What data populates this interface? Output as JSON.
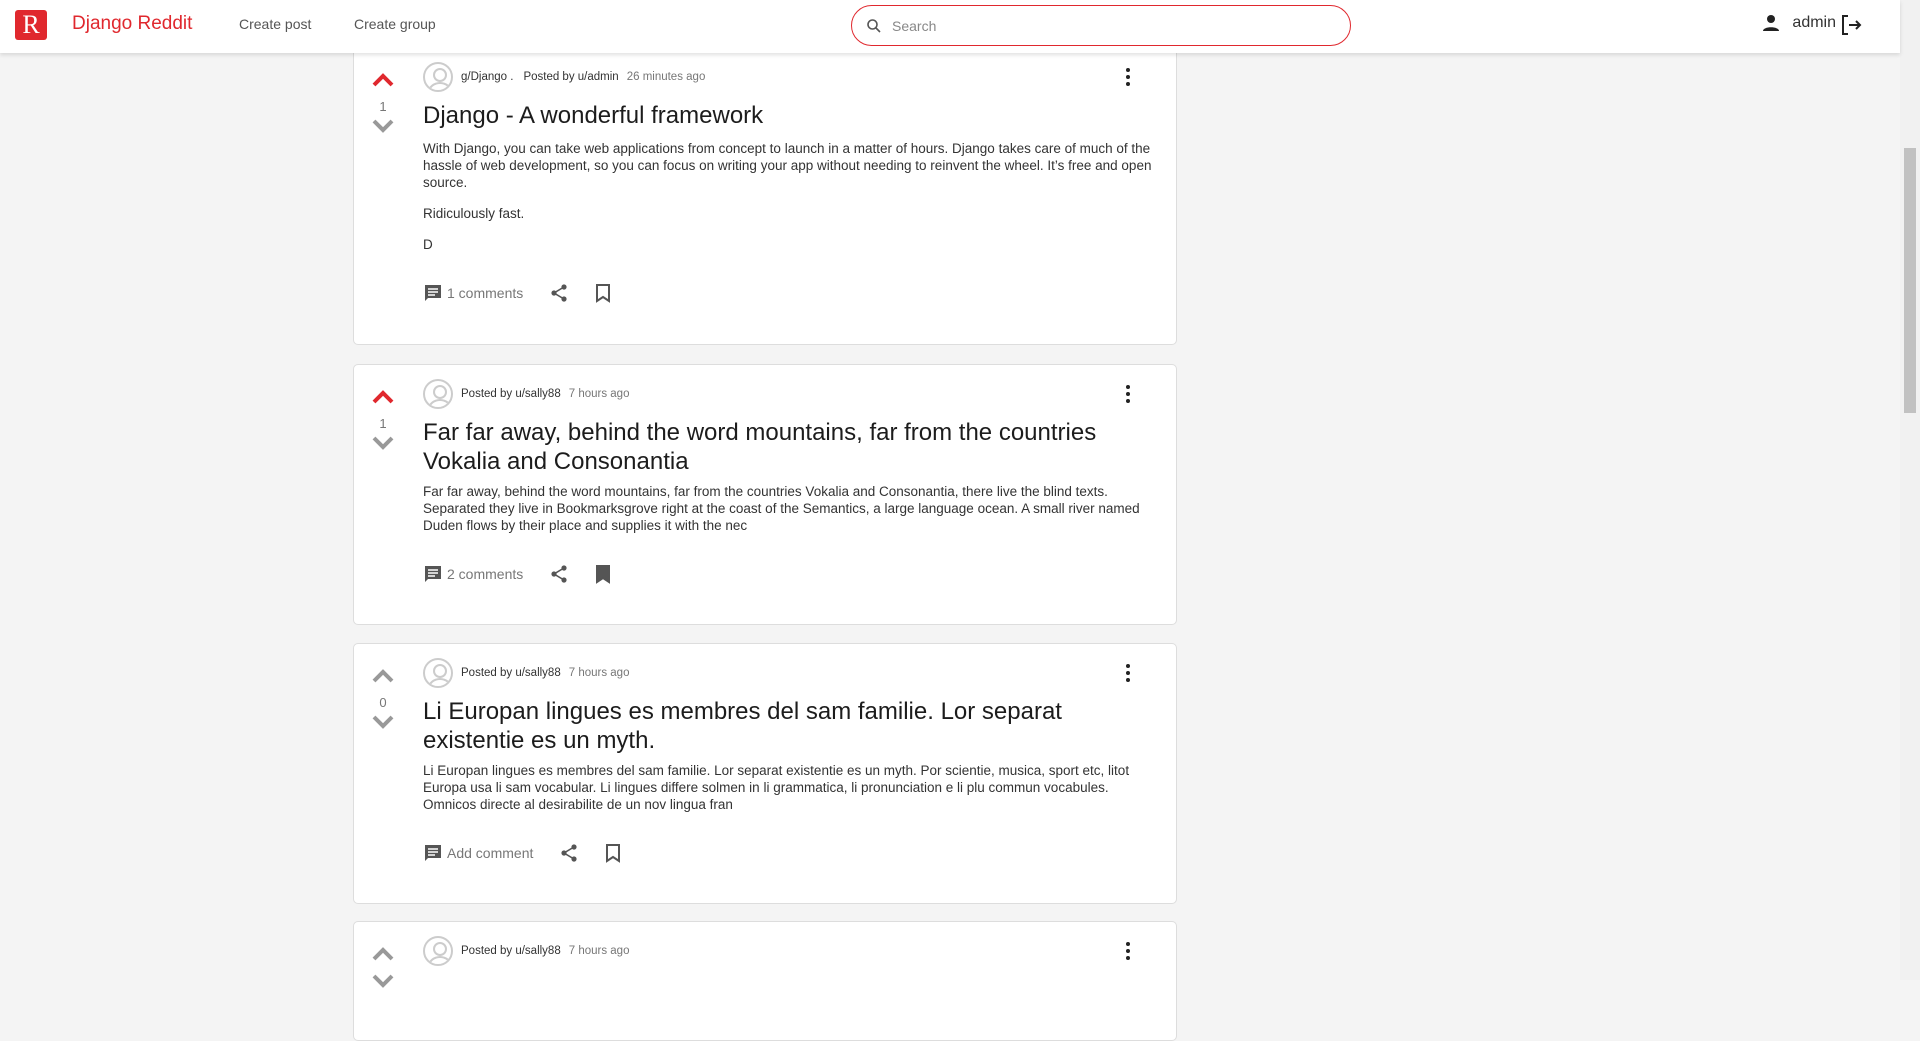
{
  "header": {
    "logo_letter": "R",
    "brand": "Django Reddit",
    "nav": [
      "Create post",
      "Create group"
    ],
    "search_placeholder": "Search",
    "username": "admin"
  },
  "colors": {
    "accent": "#e0282e",
    "upvoted": "#e0282e",
    "neutral": "#999999"
  },
  "posts": [
    {
      "group": "g/Django .",
      "posted_by": "Posted by u/admin",
      "time": "26 minutes ago",
      "votes": "1",
      "upvoted": true,
      "title": "Django - A wonderful framework",
      "paragraphs": [
        "With Django, you can take web applications from concept to launch in a matter of hours. Django takes care of much of the hassle of web development, so you can focus on writing your app without needing to reinvent the wheel. It’s free and open source.",
        "Ridiculously fast.",
        "D"
      ],
      "comments": "1 comments",
      "bookmarked": false
    },
    {
      "group": "",
      "posted_by": "Posted by u/sally88",
      "time": "7 hours ago",
      "votes": "1",
      "upvoted": true,
      "title": "Far far away, behind the word mountains, far from the countries Vokalia and Consonantia",
      "paragraphs": [
        "Far far away, behind the word mountains, far from the countries Vokalia and Consonantia, there live the blind texts. Separated they live in Bookmarksgrove right at the coast of the Semantics, a large language ocean. A small river named Duden flows by their place and supplies it with the nec"
      ],
      "comments": "2 comments",
      "bookmarked": true
    },
    {
      "group": "",
      "posted_by": "Posted by u/sally88",
      "time": "7 hours ago",
      "votes": "0",
      "upvoted": false,
      "title": "Li Europan lingues es membres del sam familie. Lor separat existentie es un myth.",
      "paragraphs": [
        "Li Europan lingues es membres del sam familie. Lor separat existentie es un myth. Por scientie, musica, sport etc, litot Europa usa li sam vocabular. Li lingues differe solmen in li grammatica, li pronunciation e li plu commun vocabules. Omnicos directe al desirabilite de un nov lingua fran"
      ],
      "comments": "Add comment",
      "bookmarked": false
    },
    {
      "group": "",
      "posted_by": "Posted by u/sally88",
      "time": "7 hours ago",
      "votes": "",
      "upvoted": false,
      "title": "",
      "paragraphs": [],
      "comments": "",
      "bookmarked": false
    }
  ]
}
